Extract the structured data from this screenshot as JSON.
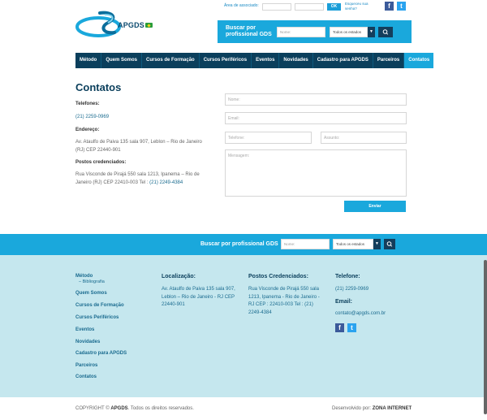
{
  "header": {
    "brand": "APGDS",
    "assoc_label": "Área de associado:",
    "ok_label": "OK",
    "forgot_label": "Esqueceu sua senha?",
    "search_label": "Buscar por profissional GDS",
    "name_placeholder": "Nome:",
    "state_select": "Todos os estados"
  },
  "nav": {
    "items": [
      "Método",
      "Quem Somos",
      "Cursos de Formação",
      "Cursos Periféricos",
      "Eventos",
      "Novidades",
      "Cadastro para APGDS",
      "Parceiros",
      "Contatos"
    ]
  },
  "content": {
    "title": "Contatos",
    "phones_label": "Telefones:",
    "phone": "(21) 2259-0969",
    "address_label": "Endereço:",
    "address": "Av. Ataulfo de Paiva 135 sala 907, Leblon – Rio de Janeiro (RJ) CEP 22440-901",
    "posts_label": "Postos credenciados:",
    "posts_text": "Rua Visconde de Pirajá 550 sala 1213, Ipanema – Rio de Janeiro (RJ) CEP 22410-003 Tel :",
    "posts_phone": "(21) 2249-4384"
  },
  "form": {
    "name_ph": "Nome:",
    "email_ph": "Email:",
    "phone_ph": "Telefone:",
    "subject_ph": "Assunto:",
    "message_ph": "Mensagem:",
    "send": "Enviar"
  },
  "band": {
    "label": "Buscar por profissional GDS",
    "name_placeholder": "Nome:",
    "state_select": "Todos os estados"
  },
  "footer": {
    "nav": [
      "Método",
      "Quem Somos",
      "Cursos de Formação",
      "Cursos Periféricos",
      "Eventos",
      "Novidades",
      "Cadastro para APGDS",
      "Parceiros",
      "Contatos"
    ],
    "nav_sub": "– Bibliografia",
    "location_head": "Localização:",
    "location": "Av. Ataulfo de Paiva 135 sala 907, Leblon – Rio de Janeiro - RJ CEP 22440-901",
    "posts_head": "Postos Credenciados:",
    "posts": "Rua Visconde de Pirajá 550 sala 1213, Ipanema - Rio de Janeiro - RJ CEP : 22410-003 Tel : (21) 2249-4384",
    "phone_head": "Telefone:",
    "phone": "(21) 2259-0969",
    "email_head": "Email:",
    "email": "contato@apgds.com.br",
    "copyright_pre": "COPYRIGHT © ",
    "copyright_brand": "APGDS",
    "copyright_post": ". Todos os direitos reservados.",
    "dev_pre": "Desenvolvido por: ",
    "dev_brand": "ZONA INTERNET"
  },
  "colors": {
    "accent": "#1aa8dc",
    "nav_bg": "#0b3f5c",
    "footer_bg": "#c5e7ee"
  }
}
